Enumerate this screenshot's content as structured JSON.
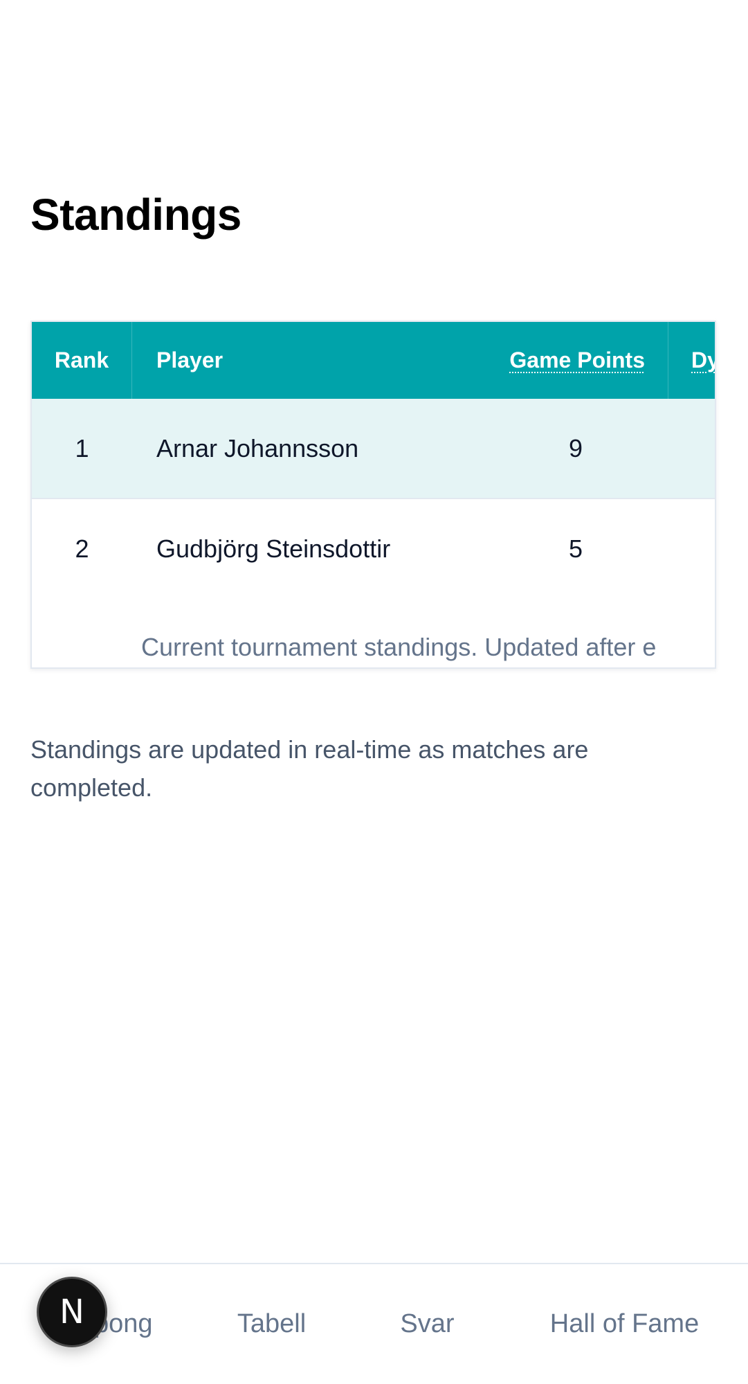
{
  "page": {
    "title": "Standings",
    "note": "Standings are updated in real-time as matches are completed."
  },
  "standings": {
    "headers": {
      "rank": "Rank",
      "player": "Player",
      "game_points": "Game Points",
      "dynamic": "Dyna"
    },
    "rows": [
      {
        "rank": "1",
        "player": "Arnar Johannsson",
        "game_points": "9"
      },
      {
        "rank": "2",
        "player": "Gudbjörg Steinsdottir",
        "game_points": "5"
      }
    ],
    "caption": "Current tournament standings. Updated after e"
  },
  "bottom_nav": {
    "items": [
      "Kupong",
      "Tabell",
      "Svar",
      "Hall of Fame"
    ]
  },
  "badge": {
    "letter": "N"
  }
}
